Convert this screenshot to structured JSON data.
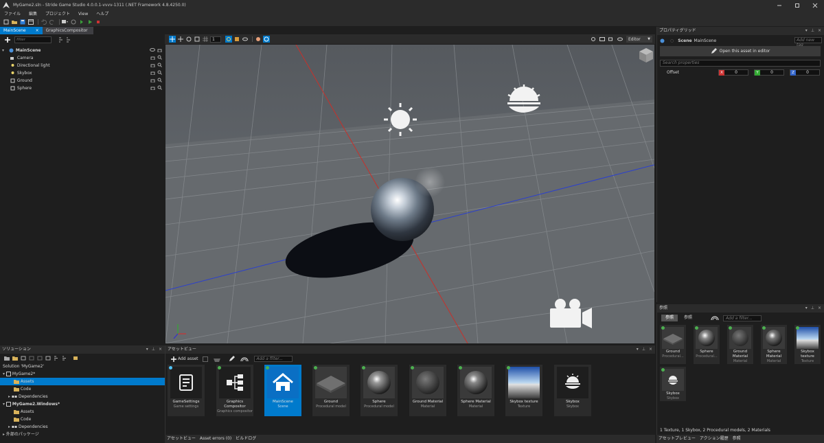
{
  "window": {
    "title": "MyGame2.sln - Stride Game Studio 4.0.0.1-vvvv-1311 (.NET Framework 4.8.4250.0)"
  },
  "menu": [
    "ファイル",
    "編集",
    "プロジェクト",
    "View",
    "ヘルプ"
  ],
  "tabs": [
    "MainScene",
    "GraphicsCompositor"
  ],
  "scene": {
    "filter_placeholder": "filter",
    "root": "MainScene",
    "entities": [
      "Camera",
      "Directional light",
      "Skybox",
      "Ground",
      "Sphere"
    ]
  },
  "viewport_toolbar": {
    "grid_value": "1",
    "mode": "Editor"
  },
  "properties": {
    "title": "プロパティグリッド",
    "scene_label": "Scene",
    "scene_name": "MainScene",
    "tag_placeholder": "Add new tag",
    "open_button": "Open this asset in editor",
    "search_placeholder": "Search properties",
    "offset_label": "Offset",
    "offset": {
      "x": "0",
      "y": "0",
      "z": "0"
    },
    "axis_x": "X",
    "axis_y": "Y",
    "axis_z": "Z"
  },
  "references": {
    "title": "参照",
    "tabs": [
      "参照",
      "参照"
    ],
    "filter_placeholder": "Add a filter...",
    "items": [
      {
        "name": "Ground",
        "type": "Procedural..."
      },
      {
        "name": "Sphere",
        "type": "Procedural..."
      },
      {
        "name": "Ground Material",
        "type": "Material"
      },
      {
        "name": "Sphere Material",
        "type": "Material"
      },
      {
        "name": "Skybox texture",
        "type": "Texture"
      },
      {
        "name": "Skybox",
        "type": "Skybox"
      }
    ],
    "status": "1 Texture, 1 Skybox, 2 Procedural models, 2 Materials"
  },
  "solution": {
    "title": "ソリューション",
    "rows": [
      "Solution 'MyGame2'",
      "MyGame2*",
      "Assets",
      "Code",
      "Dependencies",
      "MyGame2.Windows*",
      "Assets",
      "Code",
      "Dependencies",
      "外部のパッケージ"
    ]
  },
  "assets": {
    "title": "アセットビュー",
    "add_asset": "Add asset",
    "filter_placeholder": "Add a filter...",
    "items": [
      {
        "name": "GameSettings",
        "type": "Game settings"
      },
      {
        "name": "Graphics Compositor",
        "type": "Graphics compositor"
      },
      {
        "name": "MainScene",
        "type": "Scene"
      },
      {
        "name": "Ground",
        "type": "Procedural model"
      },
      {
        "name": "Sphere",
        "type": "Procedural model"
      },
      {
        "name": "Ground Material",
        "type": "Material"
      },
      {
        "name": "Sphere Material",
        "type": "Material"
      },
      {
        "name": "Skybox texture",
        "type": "Texture"
      },
      {
        "name": "Skybox",
        "type": "Skybox"
      }
    ]
  },
  "bottom_tabs_left": [
    "アセットビュー",
    "Asset errors (0)",
    "ビルドログ"
  ],
  "bottom_tabs_right": [
    "アセットプレビュー",
    "アクション履歴",
    "参照"
  ]
}
